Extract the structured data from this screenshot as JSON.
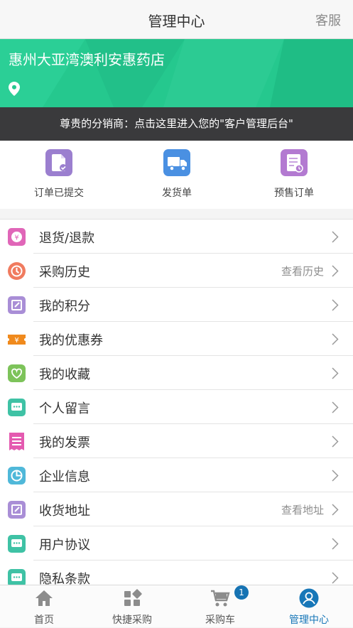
{
  "header": {
    "title": "管理中心",
    "right_action": "客服"
  },
  "banner": {
    "store_name": "惠州大亚湾澳利安惠药店"
  },
  "distributor_bar": {
    "text": "尊贵的分销商：点击这里进入您的\"客户管理后台\""
  },
  "quick_actions": [
    {
      "label": "订单已提交",
      "icon": "document-check-icon",
      "color": "#9b7fcf"
    },
    {
      "label": "发货单",
      "icon": "truck-icon",
      "color": "#4a90e2"
    },
    {
      "label": "预售订单",
      "icon": "presale-doc-icon",
      "color": "#b37ad1"
    }
  ],
  "menu": [
    {
      "label": "退货/退款",
      "hint": "",
      "icon": "refund-icon",
      "color": "#e066b8"
    },
    {
      "label": "采购历史",
      "hint": "查看历史",
      "icon": "history-icon",
      "color": "#f07b5f"
    },
    {
      "label": "我的积分",
      "hint": "",
      "icon": "points-icon",
      "color": "#a98ed6"
    },
    {
      "label": "我的优惠券",
      "hint": "",
      "icon": "coupon-icon",
      "color": "#f08a1d"
    },
    {
      "label": "我的收藏",
      "hint": "",
      "icon": "heart-icon",
      "color": "#7dc35a"
    },
    {
      "label": "个人留言",
      "hint": "",
      "icon": "message-icon",
      "color": "#3fc2a5"
    },
    {
      "label": "我的发票",
      "hint": "",
      "icon": "invoice-icon",
      "color": "#e45ab0"
    },
    {
      "label": "企业信息",
      "hint": "",
      "icon": "pie-chart-icon",
      "color": "#4fb8d9"
    },
    {
      "label": "收货地址",
      "hint": "查看地址",
      "icon": "address-icon",
      "color": "#a98ed6"
    },
    {
      "label": "用户协议",
      "hint": "",
      "icon": "agreement-icon",
      "color": "#3fc2a5"
    },
    {
      "label": "隐私条款",
      "hint": "",
      "icon": "privacy-icon",
      "color": "#3fc2a5"
    }
  ],
  "tabbar": [
    {
      "label": "首页",
      "icon": "home-icon",
      "active": false
    },
    {
      "label": "快捷采购",
      "icon": "grid-icon",
      "active": false
    },
    {
      "label": "采购车",
      "icon": "cart-icon",
      "active": false,
      "badge": "1"
    },
    {
      "label": "管理中心",
      "icon": "user-circle-icon",
      "active": true
    }
  ],
  "colors": {
    "banner": "#25c88e",
    "accent": "#1777b8",
    "dark_bar": "#3a3a3c"
  }
}
